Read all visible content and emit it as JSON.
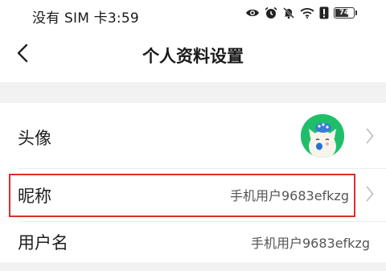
{
  "status_bar": {
    "carrier_time": "没有 SIM 卡3:59",
    "battery_level": "74",
    "icons": [
      "eye-icon",
      "alarm-icon",
      "mute-icon",
      "wifi-icon",
      "alert-icon",
      "battery-icon"
    ]
  },
  "nav": {
    "back_icon": "chevron-left-icon",
    "title": "个人资料设置"
  },
  "rows": [
    {
      "label": "头像",
      "type": "avatar"
    },
    {
      "label": "昵称",
      "value": "手机用户9683efkzg"
    },
    {
      "label": "用户名",
      "value": "手机用户9683efkzg"
    }
  ],
  "colors": {
    "avatar_bg": "#1fbf6a",
    "highlight": "#d8312e",
    "band": "#f2f2f2"
  }
}
